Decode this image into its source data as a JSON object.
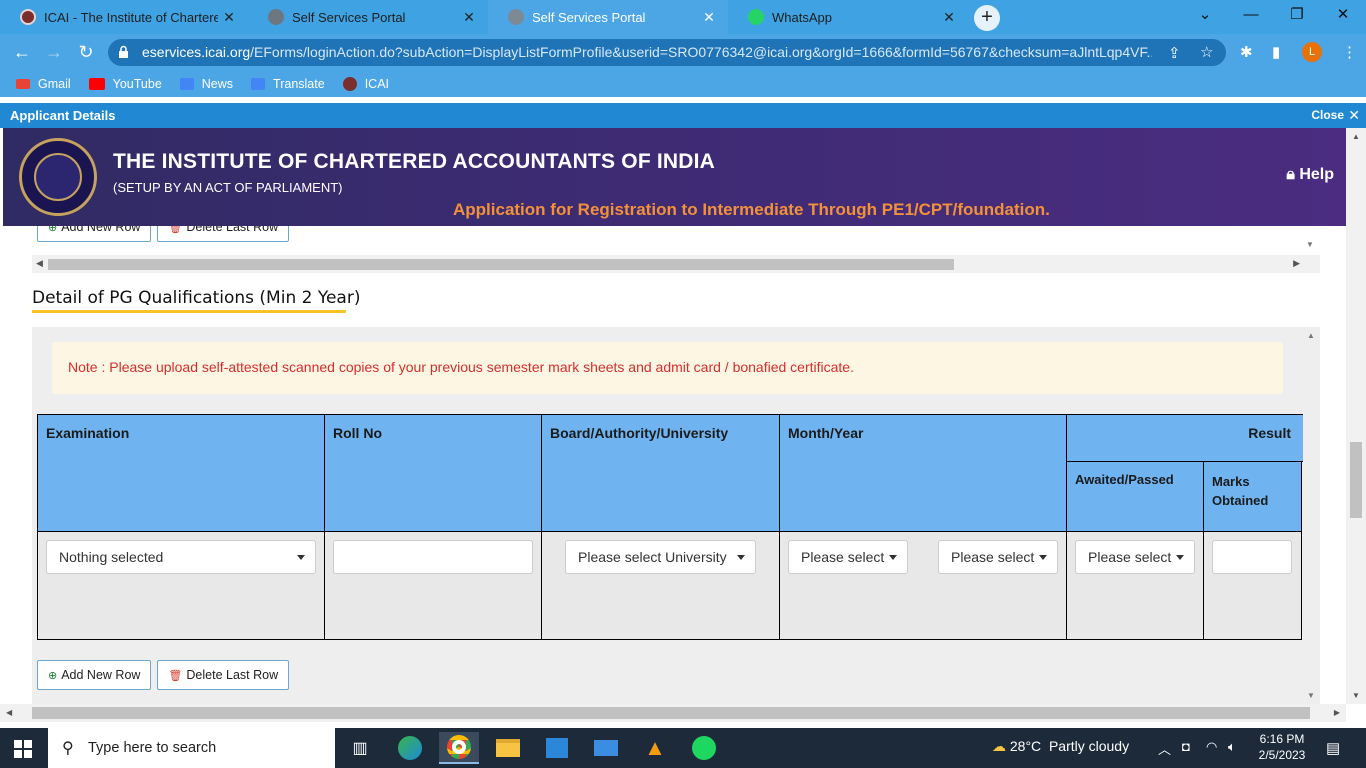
{
  "browser": {
    "tabs": [
      {
        "title": "ICAI - The Institute of Chartered Accountants of India",
        "icon": "icai-favicon",
        "active": false
      },
      {
        "title": "Self Services Portal",
        "icon": "globe-icon",
        "active": false
      },
      {
        "title": "Self Services Portal",
        "icon": "globe-icon",
        "active": true
      },
      {
        "title": "WhatsApp",
        "icon": "whatsapp-icon",
        "active": false
      }
    ],
    "url_domain": "eservices.icai.org",
    "url_path": "/EForms/loginAction.do?subAction=DisplayListFormProfile&userid=SRO0776342@icai.org&orgId=1666&formId=56767&checksum=aJlntLqp4VF...",
    "profile_initial": "L",
    "bookmarks": [
      "Gmail",
      "YouTube",
      "News",
      "Translate",
      "ICAI"
    ]
  },
  "modal": {
    "title": "Applicant Details",
    "close_label": "Close"
  },
  "banner": {
    "institute": "THE INSTITUTE OF CHARTERED ACCOUNTANTS OF INDIA",
    "subtitle": "(SETUP BY AN ACT OF PARLIAMENT)",
    "help": "Help",
    "application_title": "Application for Registration to Intermediate Through PE1/CPT/foundation."
  },
  "buttons": {
    "add_row": "Add New Row",
    "delete_row": "Delete Last Row"
  },
  "section": {
    "title": "Detail of PG Qualifications (Min 2 Year)",
    "note": "Note : Please upload self-attested scanned copies of your previous semester mark sheets and admit card / bonafied certificate."
  },
  "table": {
    "headers": {
      "examination": "Examination",
      "roll_no": "Roll No",
      "board": "Board/Authority/University",
      "month_year": "Month/Year",
      "result": "Result",
      "awaited_passed": "Awaited/Passed",
      "marks_obtained": "Marks Obtained"
    },
    "row": {
      "examination": "Nothing selected",
      "roll_no": "",
      "university": "Please select University",
      "month": "Please select",
      "year": "Please select",
      "result": "Please select",
      "marks": ""
    }
  },
  "taskbar": {
    "search_placeholder": "Type here to search",
    "weather_temp": "28°C",
    "weather_desc": "Partly cloudy",
    "time": "6:16 PM",
    "date": "2/5/2023"
  },
  "colors": {
    "chrome_blue": "#3fa2e2",
    "banner_purple": "#3c2b72",
    "table_header_blue": "#6fb4f1",
    "note_red": "#d32f2f",
    "app_title_orange": "#f3903a",
    "underline_yellow": "#f7c325"
  }
}
